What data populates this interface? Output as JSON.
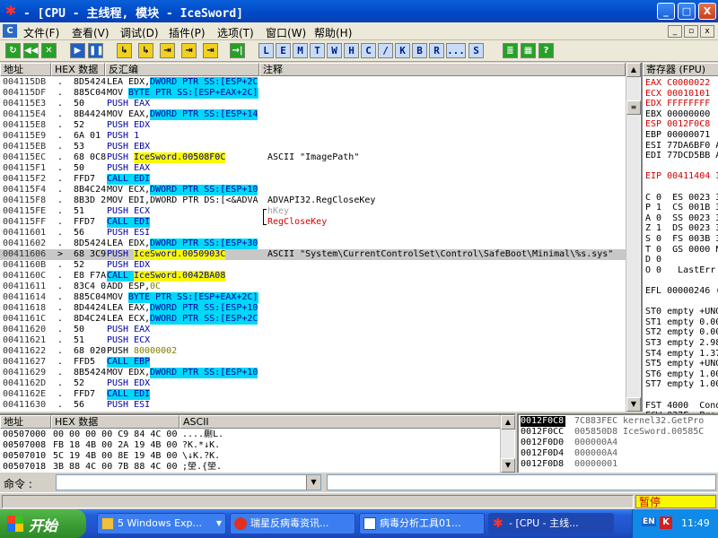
{
  "window": {
    "title": "- [CPU - 主线程, 模块 - IceSword]",
    "btn_min": "_",
    "btn_max": "□",
    "btn_close": "X"
  },
  "menu": {
    "doc_icon": "C",
    "items": [
      "文件(F)",
      "查看(V)",
      "调试(D)",
      "插件(P)",
      "选项(T)",
      "窗口(W)",
      "帮助(H)"
    ],
    "mdi_min": "_",
    "mdi_max": "▫",
    "mdi_close": "x"
  },
  "toolbar": {
    "control_buttons": [
      "↻",
      "◀◀",
      "✕",
      "▶",
      "❚❚",
      "↳",
      "↳",
      "⇥",
      "⇥",
      "⇥",
      "→|"
    ],
    "letter_buttons": [
      "L",
      "E",
      "M",
      "T",
      "W",
      "H",
      "C",
      "/",
      "K",
      "B",
      "R",
      "...",
      "S"
    ],
    "extra_buttons": [
      "≣",
      "▦",
      "?"
    ]
  },
  "disasm": {
    "headers": {
      "addr": "地址",
      "hex": "HEX 数据",
      "disasm": "反汇编",
      "comment": "注释"
    },
    "rows": [
      {
        "addr": "004115DB",
        "m": ".",
        "hex": "8D5424",
        "ins": "LEA EDX,",
        "ops": "DWORD PTR SS:[ESP+2C",
        "hl": "cyan",
        "cm": ""
      },
      {
        "addr": "004115DF",
        "m": ".",
        "hex": "885C04",
        "ins": "MOV ",
        "ops": "BYTE PTR SS:[ESP+EAX+2C]",
        "hl": "cyan",
        "cm": ""
      },
      {
        "addr": "004115E3",
        "m": ".",
        "hex": "50",
        "ins": "",
        "ops": "PUSH EAX",
        "hl": "push",
        "cm": ""
      },
      {
        "addr": "004115E4",
        "m": ".",
        "hex": "8B4424",
        "ins": "MOV EAX,",
        "ops": "DWORD PTR SS:[ESP+14",
        "hl": "cyan",
        "cm": ""
      },
      {
        "addr": "004115E8",
        "m": ".",
        "hex": "52",
        "ins": "",
        "ops": "PUSH EDX",
        "hl": "push",
        "cm": ""
      },
      {
        "addr": "004115E9",
        "m": ".",
        "hex": "6A 01",
        "ins": "",
        "ops": "PUSH 1",
        "hl": "push",
        "cm": ""
      },
      {
        "addr": "004115EB",
        "m": ".",
        "hex": "53",
        "ins": "",
        "ops": "PUSH EBX",
        "hl": "push",
        "cm": ""
      },
      {
        "addr": "004115EC",
        "m": ".",
        "hex": "68 0C8",
        "ins": "PUSH ",
        "ops": "IceSword.00508F0C",
        "hl": "yellow",
        "cm": "ASCII \"ImagePath\""
      },
      {
        "addr": "004115F1",
        "m": ".",
        "hex": "50",
        "ins": "",
        "ops": "PUSH EAX",
        "hl": "push",
        "cm": ""
      },
      {
        "addr": "004115F2",
        "m": ".",
        "hex": "FFD7",
        "ins": "",
        "ops": "CALL EDI",
        "hl": "call",
        "cm": ""
      },
      {
        "addr": "004115F4",
        "m": ".",
        "hex": "8B4C24",
        "ins": "MOV ECX,",
        "ops": "DWORD PTR SS:[ESP+10",
        "hl": "cyan",
        "cm": ""
      },
      {
        "addr": "004115F8",
        "m": ".",
        "hex": "8B3D 2",
        "ins": "MOV EDI,DWORD PTR DS:[<&ADVA",
        "ops": "",
        "hl": "plain",
        "cm": "ADVAPI32.RegCloseKey"
      },
      {
        "addr": "004115FE",
        "m": ".",
        "hex": "51",
        "ins": "",
        "ops": "PUSH ECX",
        "hl": "push",
        "cm": "hKey"
      },
      {
        "addr": "004115FF",
        "m": ".",
        "hex": "FFD7",
        "ins": "",
        "ops": "CALL EDI",
        "hl": "call",
        "cm": "RegCloseKey"
      },
      {
        "addr": "00411601",
        "m": ".",
        "hex": "56",
        "ins": "",
        "ops": "PUSH ESI",
        "hl": "push",
        "cm": ""
      },
      {
        "addr": "00411602",
        "m": ".",
        "hex": "8D5424",
        "ins": "LEA EDX,",
        "ops": "DWORD PTR SS:[ESP+30",
        "hl": "cyan",
        "cm": ""
      },
      {
        "addr": "00411606",
        "m": ">",
        "hex": "68 3C9",
        "ins": "PUSH ",
        "ops": "IceSword.0050903C",
        "hl": "yellow",
        "cm": "ASCII \"System\\CurrentControlSet\\Control\\SafeBoot\\Minimal\\%s.sys\"",
        "sel": true
      },
      {
        "addr": "0041160B",
        "m": ".",
        "hex": "52",
        "ins": "",
        "ops": "PUSH EDX",
        "hl": "push",
        "cm": ""
      },
      {
        "addr": "0041160C",
        "m": ".",
        "hex": "E8 F7A",
        "ins": "CALL ",
        "ops": "IceSword.0042BA08",
        "hl": "callyellow",
        "cm": ""
      },
      {
        "addr": "00411611",
        "m": ".",
        "hex": "83C4 0",
        "ins": "ADD ESP,",
        "ops": "0C",
        "hl": "addimm",
        "cm": ""
      },
      {
        "addr": "00411614",
        "m": ".",
        "hex": "885C04",
        "ins": "MOV ",
        "ops": "BYTE PTR SS:[ESP+EAX+2C]",
        "hl": "cyan",
        "cm": ""
      },
      {
        "addr": "00411618",
        "m": ".",
        "hex": "8D4424",
        "ins": "LEA EAX,",
        "ops": "DWORD PTR SS:[ESP+10",
        "hl": "cyan",
        "cm": ""
      },
      {
        "addr": "0041161C",
        "m": ".",
        "hex": "8D4C24",
        "ins": "LEA ECX,",
        "ops": "DWORD PTR SS:[ESP+2C",
        "hl": "cyan",
        "cm": ""
      },
      {
        "addr": "00411620",
        "m": ".",
        "hex": "50",
        "ins": "",
        "ops": "PUSH EAX",
        "hl": "push",
        "cm": ""
      },
      {
        "addr": "00411621",
        "m": ".",
        "hex": "51",
        "ins": "",
        "ops": "PUSH ECX",
        "hl": "push",
        "cm": ""
      },
      {
        "addr": "00411622",
        "m": ".",
        "hex": "68 020",
        "ins": "PUSH ",
        "ops": "80000002",
        "hl": "pushimm",
        "cm": ""
      },
      {
        "addr": "00411627",
        "m": ".",
        "hex": "FFD5",
        "ins": "",
        "ops": "CALL EBP",
        "hl": "call",
        "cm": ""
      },
      {
        "addr": "00411629",
        "m": ".",
        "hex": "8B5424",
        "ins": "MOV EDX,",
        "ops": "DWORD PTR SS:[ESP+10",
        "hl": "cyan",
        "cm": ""
      },
      {
        "addr": "0041162D",
        "m": ".",
        "hex": "52",
        "ins": "",
        "ops": "PUSH EDX",
        "hl": "push",
        "cm": ""
      },
      {
        "addr": "0041162E",
        "m": ".",
        "hex": "FFD7",
        "ins": "",
        "ops": "CALL EDI",
        "hl": "call",
        "cm": ""
      },
      {
        "addr": "00411630",
        "m": ".",
        "hex": "56",
        "ins": "",
        "ops": "PUSH ESI",
        "hl": "push",
        "cm": ""
      }
    ]
  },
  "registers": {
    "header": "寄存器 (FPU)",
    "rows": [
      {
        "t": "EAX C0000022",
        "c": "red"
      },
      {
        "t": "ECX 00010101",
        "c": "red"
      },
      {
        "t": "EDX FFFFFFFF",
        "c": "red"
      },
      {
        "t": "EBX 00000000",
        "c": "norm"
      },
      {
        "t": "ESP 0012F0C8",
        "c": "red"
      },
      {
        "t": "EBP 00000071",
        "c": "norm"
      },
      {
        "t": "ESI 77DA6BF0 A",
        "c": "norm"
      },
      {
        "t": "EDI 77DCD5BB A",
        "c": "norm"
      },
      {
        "t": "",
        "c": "norm"
      },
      {
        "t": "EIP 00411404 I",
        "c": "red"
      },
      {
        "t": "",
        "c": "norm"
      },
      {
        "t": "C 0  ES 0023 3",
        "c": "norm"
      },
      {
        "t": "P 1  CS 001B 3",
        "c": "norm"
      },
      {
        "t": "A 0  SS 0023 3",
        "c": "norm"
      },
      {
        "t": "Z 1  DS 0023 3",
        "c": "norm"
      },
      {
        "t": "S 0  FS 003B 3",
        "c": "norm"
      },
      {
        "t": "T 0  GS 0000 N",
        "c": "norm"
      },
      {
        "t": "D 0",
        "c": "norm"
      },
      {
        "t": "O 0   LastErr E",
        "c": "norm"
      },
      {
        "t": "",
        "c": "norm"
      },
      {
        "t": "EFL 00000246 (",
        "c": "norm"
      },
      {
        "t": "",
        "c": "norm"
      },
      {
        "t": "ST0 empty +UNO",
        "c": "norm"
      },
      {
        "t": "ST1 empty 0.00",
        "c": "norm"
      },
      {
        "t": "ST2 empty 0.00",
        "c": "norm"
      },
      {
        "t": "ST3 empty 2.98",
        "c": "norm"
      },
      {
        "t": "ST4 empty 1.37",
        "c": "norm"
      },
      {
        "t": "ST5 empty +UNO",
        "c": "norm"
      },
      {
        "t": "ST6 empty 1.00",
        "c": "norm"
      },
      {
        "t": "ST7 empty 1.00",
        "c": "norm"
      },
      {
        "t": "",
        "c": "norm"
      },
      {
        "t": "FST 4000  Cond",
        "c": "norm"
      },
      {
        "t": "FCW 027F  Prec",
        "c": "norm"
      }
    ]
  },
  "dump": {
    "headers": {
      "addr": "地址",
      "hex": "HEX 数据",
      "ascii": "ASCII"
    },
    "rows": [
      {
        "addr": "00507000",
        "hex": "00 00 00 00 C9 84 4C 00",
        "ascii": "....蒯L."
      },
      {
        "addr": "00507008",
        "hex": "FB 18 4B 00 2A 19 4B 00",
        "ascii": "?K.*↓K."
      },
      {
        "addr": "00507010",
        "hex": "5C 19 4B 00 8E 19 4B 00",
        "ascii": "\\↓K.?K."
      },
      {
        "addr": "00507018",
        "hex": "3B 88 4C 00 7B 88 4C 00",
        "ascii": ";塋.{塋."
      }
    ]
  },
  "stack": {
    "rows": [
      {
        "addr": "0012F0C8",
        "val": "7C883FEC",
        "cm": "kernel32.GetPro",
        "sel": true
      },
      {
        "addr": "0012F0CC",
        "val": "005850D8",
        "cm": "IceSword.00585C"
      },
      {
        "addr": "0012F0D0",
        "val": "000000A4",
        "cm": ""
      },
      {
        "addr": "0012F0D4",
        "val": "000000A4",
        "cm": ""
      },
      {
        "addr": "0012F0D8",
        "val": "00000001",
        "cm": ""
      }
    ]
  },
  "command": {
    "label": "命令 :",
    "value": ""
  },
  "status": {
    "state": "暂停"
  },
  "taskbar": {
    "start": "开始",
    "tasks": [
      "5 Windows Exp...",
      "瑞星反病毒资讯...",
      "病毒分析工具01...",
      "- [CPU - 主线..."
    ],
    "clock": "11:49",
    "tray_text": "EN"
  },
  "colors": {
    "accent": "#0a5fd8",
    "cyan": "#00d8f8",
    "yellow": "#f8f800",
    "red": "#d00000",
    "pause": "#f8f800"
  }
}
